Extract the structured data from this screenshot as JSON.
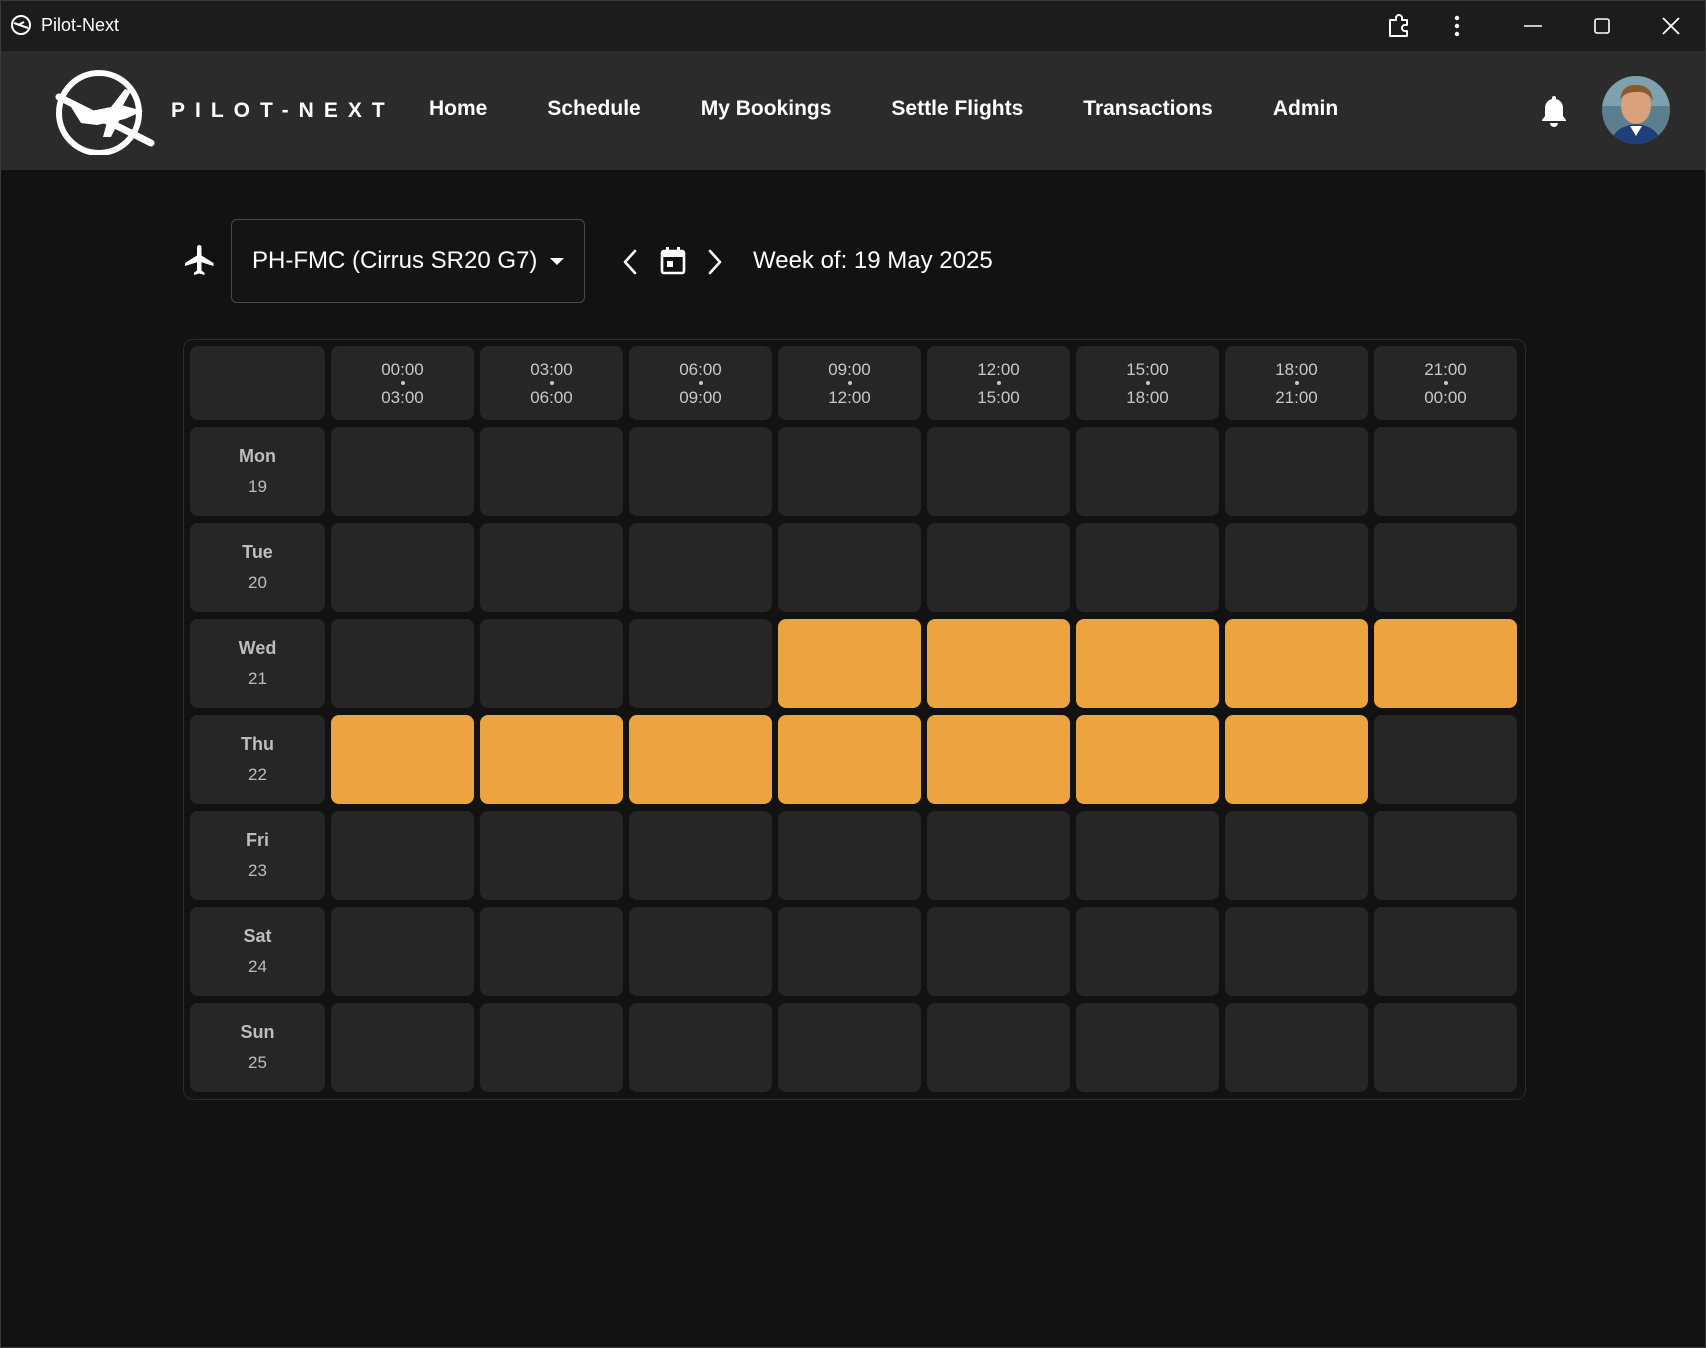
{
  "window": {
    "title": "Pilot-Next"
  },
  "header": {
    "brand": "PILOT-NEXT",
    "nav": [
      "Home",
      "Schedule",
      "My Bookings",
      "Settle Flights",
      "Transactions",
      "Admin"
    ]
  },
  "toolbar": {
    "aircraft": "PH-FMC (Cirrus SR20 G7)",
    "week_label": "Week of: 19 May 2025"
  },
  "schedule": {
    "slots": [
      {
        "start": "00:00",
        "end": "03:00"
      },
      {
        "start": "03:00",
        "end": "06:00"
      },
      {
        "start": "06:00",
        "end": "09:00"
      },
      {
        "start": "09:00",
        "end": "12:00"
      },
      {
        "start": "12:00",
        "end": "15:00"
      },
      {
        "start": "15:00",
        "end": "18:00"
      },
      {
        "start": "18:00",
        "end": "21:00"
      },
      {
        "start": "21:00",
        "end": "00:00"
      }
    ],
    "days": [
      {
        "name": "Mon",
        "date": "19",
        "booked": [
          false,
          false,
          false,
          false,
          false,
          false,
          false,
          false
        ]
      },
      {
        "name": "Tue",
        "date": "20",
        "booked": [
          false,
          false,
          false,
          false,
          false,
          false,
          false,
          false
        ]
      },
      {
        "name": "Wed",
        "date": "21",
        "booked": [
          false,
          false,
          false,
          true,
          true,
          true,
          true,
          true
        ]
      },
      {
        "name": "Thu",
        "date": "22",
        "booked": [
          true,
          true,
          true,
          true,
          true,
          true,
          true,
          false
        ]
      },
      {
        "name": "Fri",
        "date": "23",
        "booked": [
          false,
          false,
          false,
          false,
          false,
          false,
          false,
          false
        ]
      },
      {
        "name": "Sat",
        "date": "24",
        "booked": [
          false,
          false,
          false,
          false,
          false,
          false,
          false,
          false
        ]
      },
      {
        "name": "Sun",
        "date": "25",
        "booked": [
          false,
          false,
          false,
          false,
          false,
          false,
          false,
          false
        ]
      }
    ]
  },
  "colors": {
    "booked": "#eba43f",
    "cell": "#262626",
    "background": "#121212",
    "header": "#2b2b2b"
  }
}
